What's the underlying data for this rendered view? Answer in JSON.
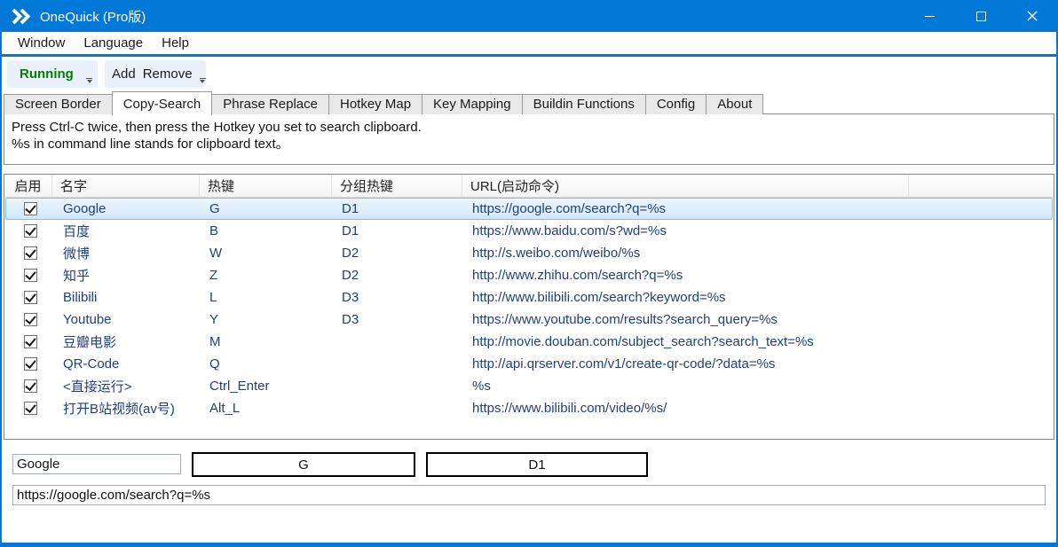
{
  "window": {
    "title": "OneQuick (Pro版)"
  },
  "menu": {
    "items": [
      "Window",
      "Language",
      "Help"
    ]
  },
  "toolbar": {
    "running_label": "Running",
    "add_label": "Add",
    "remove_label": "Remove"
  },
  "tabs": {
    "items": [
      "Screen Border",
      "Copy-Search",
      "Phrase Replace",
      "Hotkey Map",
      "Key Mapping",
      "Buildin Functions",
      "Config",
      "About"
    ],
    "active_index": 1
  },
  "description": {
    "line1": "Press Ctrl-C twice, then press the Hotkey you set to search clipboard.",
    "line2": "%s in command line stands for clipboard text。"
  },
  "table": {
    "columns": [
      "启用",
      "名字",
      "热键",
      "分组热键",
      "URL(启动命令)"
    ],
    "rows": [
      {
        "enabled": true,
        "name": "Google",
        "hotkey": "G",
        "group": "D1",
        "url": "https://google.com/search?q=%s",
        "selected": true
      },
      {
        "enabled": true,
        "name": "百度",
        "hotkey": "B",
        "group": "D1",
        "url": "https://www.baidu.com/s?wd=%s",
        "selected": false
      },
      {
        "enabled": true,
        "name": "微博",
        "hotkey": "W",
        "group": "D2",
        "url": "http://s.weibo.com/weibo/%s",
        "selected": false
      },
      {
        "enabled": true,
        "name": "知乎",
        "hotkey": "Z",
        "group": "D2",
        "url": "http://www.zhihu.com/search?q=%s",
        "selected": false
      },
      {
        "enabled": true,
        "name": "Bilibili",
        "hotkey": "L",
        "group": "D3",
        "url": "http://www.bilibili.com/search?keyword=%s",
        "selected": false
      },
      {
        "enabled": true,
        "name": "Youtube",
        "hotkey": "Y",
        "group": "D3",
        "url": "https://www.youtube.com/results?search_query=%s",
        "selected": false
      },
      {
        "enabled": true,
        "name": "豆瓣电影",
        "hotkey": "M",
        "group": "",
        "url": "http://movie.douban.com/subject_search?search_text=%s",
        "selected": false
      },
      {
        "enabled": true,
        "name": "QR-Code",
        "hotkey": "Q",
        "group": "",
        "url": "http://api.qrserver.com/v1/create-qr-code/?data=%s",
        "selected": false
      },
      {
        "enabled": true,
        "name": "<直接运行>",
        "hotkey": "Ctrl_Enter",
        "group": "",
        "url": "%s",
        "selected": false
      },
      {
        "enabled": true,
        "name": "打开B站视频(av号)",
        "hotkey": "Alt_L",
        "group": "",
        "url": "https://www.bilibili.com/video/%s/",
        "selected": false
      }
    ]
  },
  "editor": {
    "name_value": "Google",
    "hotkey_value": "G",
    "group_value": "D1",
    "url_value": "https://google.com/search?q=%s"
  },
  "colors": {
    "titlebar_blue": "#0078d7",
    "running_green": "#008000",
    "row_text_navy": "#20407c",
    "selection_border": "#7cc0ee",
    "toolbar_button_bg": "#ebf1fb"
  }
}
